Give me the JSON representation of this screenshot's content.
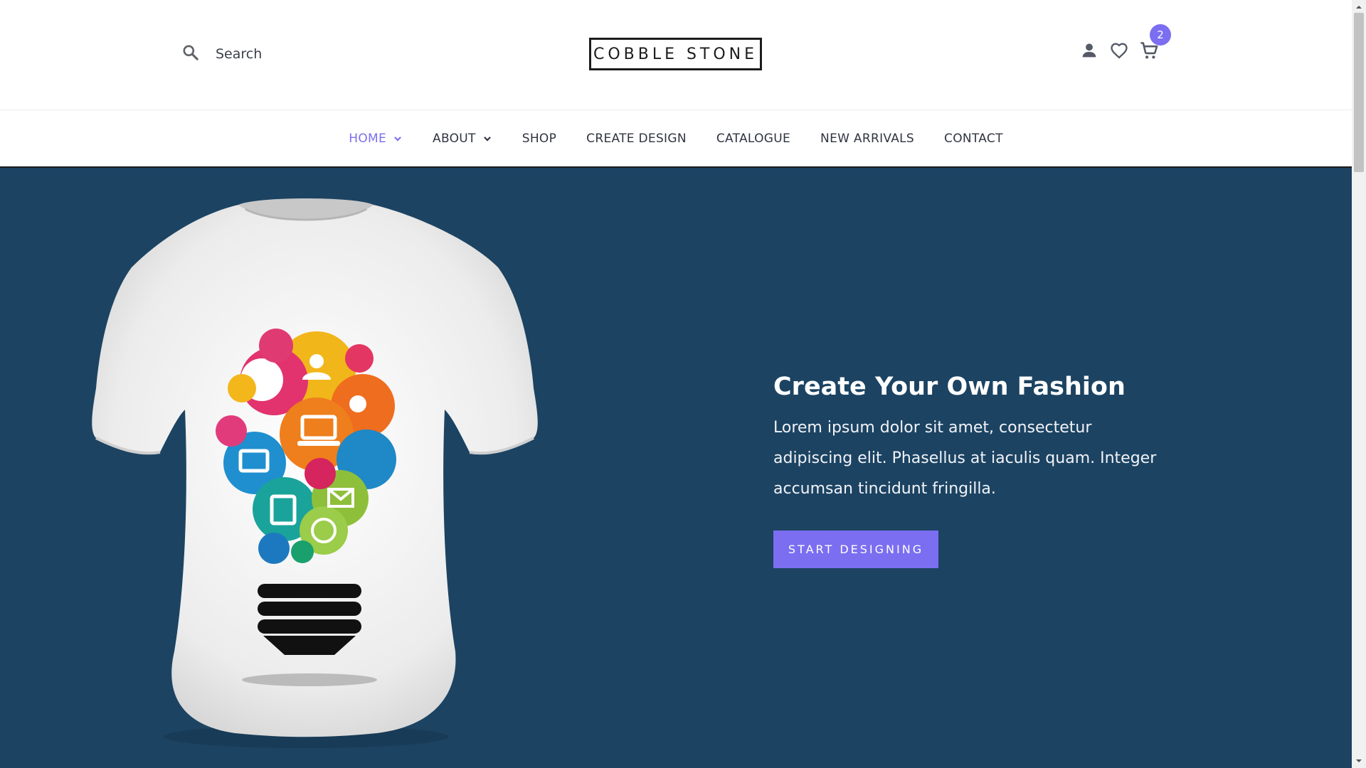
{
  "header": {
    "search": {
      "placeholder": "Search",
      "icon": "search-icon"
    },
    "logo": "COBBLE STONE",
    "icons": [
      "user-icon",
      "heart-icon",
      "cart-icon"
    ],
    "cart_count": "2"
  },
  "nav": {
    "items": [
      {
        "label": "HOME",
        "active": true,
        "dropdown": true
      },
      {
        "label": "ABOUT",
        "active": false,
        "dropdown": true
      },
      {
        "label": "SHOP",
        "active": false,
        "dropdown": false
      },
      {
        "label": "CREATE DESIGN",
        "active": false,
        "dropdown": false
      },
      {
        "label": "CATALOGUE",
        "active": false,
        "dropdown": false
      },
      {
        "label": "NEW ARRIVALS",
        "active": false,
        "dropdown": false
      },
      {
        "label": "CONTACT",
        "active": false,
        "dropdown": false
      }
    ]
  },
  "hero": {
    "title": "Create Your Own Fashion",
    "body": "Lorem ipsum dolor sit amet, consectetur adipiscing elit. Phasellus at iaculis quam. Integer accumsan tincidunt fringilla.",
    "cta_label": "START DESIGNING",
    "image": "tshirt-lightbulb-graphic"
  },
  "colors": {
    "accent": "#7b6ef0",
    "hero_background": "#1c4362",
    "text_dark": "#2f3440"
  }
}
